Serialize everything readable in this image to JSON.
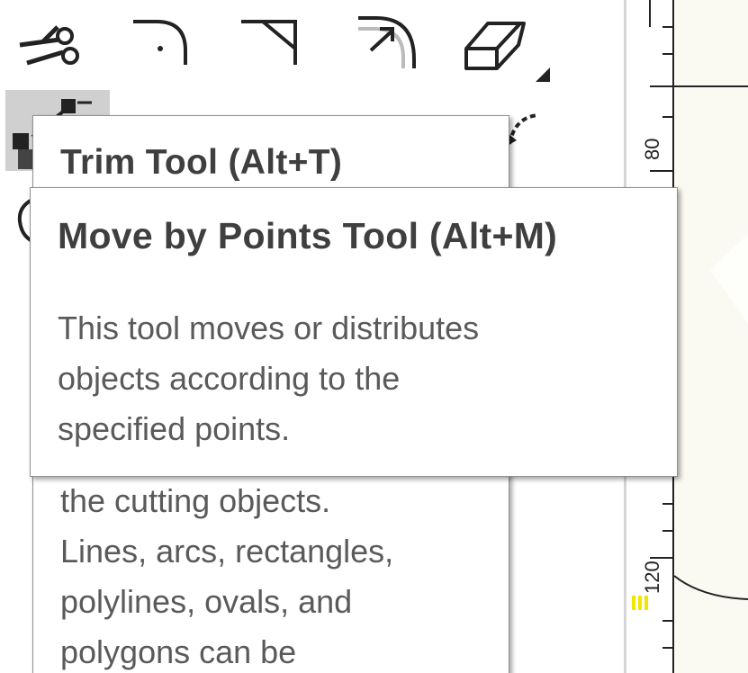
{
  "palette": {
    "tools": [
      {
        "name": "scissors-icon"
      },
      {
        "name": "arc-fillet-icon"
      },
      {
        "name": "chamfer-icon"
      },
      {
        "name": "offset-arc-icon"
      },
      {
        "name": "eraser-icon"
      }
    ]
  },
  "ruler": {
    "labels": [
      "80",
      "120"
    ]
  },
  "tooltips": {
    "trim": {
      "title": "Trim Tool (Alt+T)",
      "body_lines": [
        "the cutting objects.",
        "Lines, arcs, rectangles,",
        "polylines, ovals, and",
        "polygons can be"
      ]
    },
    "move_by_points": {
      "title": "Move by Points Tool (Alt+M)",
      "body_lines": [
        "This tool moves or distributes",
        "objects according to the",
        "specified points."
      ]
    }
  },
  "colors": {
    "canvas": "#fbfaf2",
    "selected_tool": "#d0d0d0",
    "highlight_mark": "#f2e600"
  }
}
